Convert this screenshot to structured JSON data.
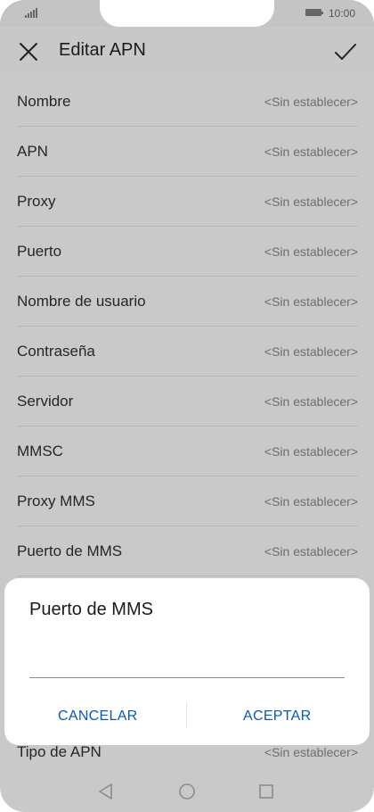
{
  "status_bar": {
    "time": "10:00",
    "signal_icon": "signal-icon",
    "battery_icon": "battery-icon"
  },
  "header": {
    "title": "Editar APN",
    "close_icon": "close-icon",
    "confirm_icon": "check-icon"
  },
  "fields": [
    {
      "label": "Nombre",
      "value": "<Sin establecer>"
    },
    {
      "label": "APN",
      "value": "<Sin establecer>"
    },
    {
      "label": "Proxy",
      "value": "<Sin establecer>"
    },
    {
      "label": "Puerto",
      "value": "<Sin establecer>"
    },
    {
      "label": "Nombre de usuario",
      "value": "<Sin establecer>"
    },
    {
      "label": "Contraseña",
      "value": "<Sin establecer>"
    },
    {
      "label": "Servidor",
      "value": "<Sin establecer>"
    },
    {
      "label": "MMSC",
      "value": "<Sin establecer>"
    },
    {
      "label": "Proxy MMS",
      "value": "<Sin establecer>"
    },
    {
      "label": "Puerto de MMS",
      "value": "<Sin establecer>"
    }
  ],
  "bottom_field": {
    "label": "Tipo de APN",
    "value": "<Sin establecer>"
  },
  "dialog": {
    "title": "Puerto de MMS",
    "input_value": "",
    "cancel_label": "CANCELAR",
    "accept_label": "ACEPTAR",
    "accent_color": "#0a59b5"
  },
  "nav_bar": {
    "back_icon": "back-triangle-icon",
    "home_icon": "home-circle-icon",
    "recent_icon": "recent-square-icon"
  }
}
